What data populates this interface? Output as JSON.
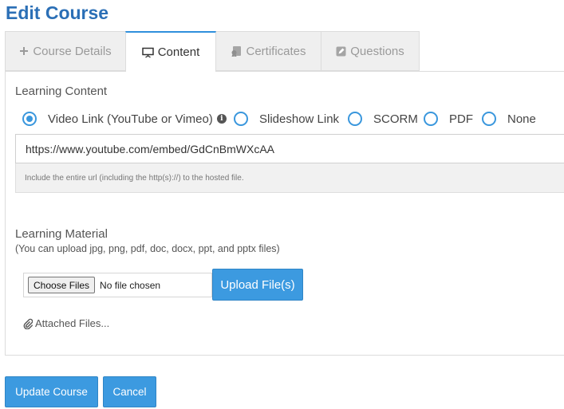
{
  "page": {
    "title": "Edit Course"
  },
  "tabs": [
    {
      "label": "Course Details",
      "icon": "plus-icon",
      "active": false
    },
    {
      "label": "Content",
      "icon": "presentation-icon",
      "active": true
    },
    {
      "label": "Certificates",
      "icon": "certificate-icon",
      "active": false
    },
    {
      "label": "Questions",
      "icon": "edit-icon",
      "active": false
    }
  ],
  "learning_content": {
    "label": "Learning Content",
    "options": [
      {
        "label": "Video Link (YouTube or Vimeo)",
        "checked": true,
        "has_info_icon": true
      },
      {
        "label": "Slideshow Link",
        "checked": false
      },
      {
        "label": "SCORM",
        "checked": false
      },
      {
        "label": "PDF",
        "checked": false
      },
      {
        "label": "None",
        "checked": false
      }
    ],
    "info_icon_glyph": "i",
    "url_value": "https://www.youtube.com/embed/GdCnBmWXcAA",
    "help_text": "Include the entire url (including the http(s)://) to the hosted file."
  },
  "learning_material": {
    "label": "Learning Material",
    "sub_label": "(You can upload jpg, png, pdf, doc, docx, ppt, and pptx files)",
    "choose_files_label": "Choose Files",
    "file_status": "No file chosen",
    "upload_button": "Upload File(s)",
    "attached_files_label": "Attached Files..."
  },
  "actions": {
    "update_label": "Update Course",
    "cancel_label": "Cancel"
  },
  "colors": {
    "accent": "#3c9ae0",
    "title": "#2b6fb6",
    "tab_inactive_bg": "#efefef"
  }
}
